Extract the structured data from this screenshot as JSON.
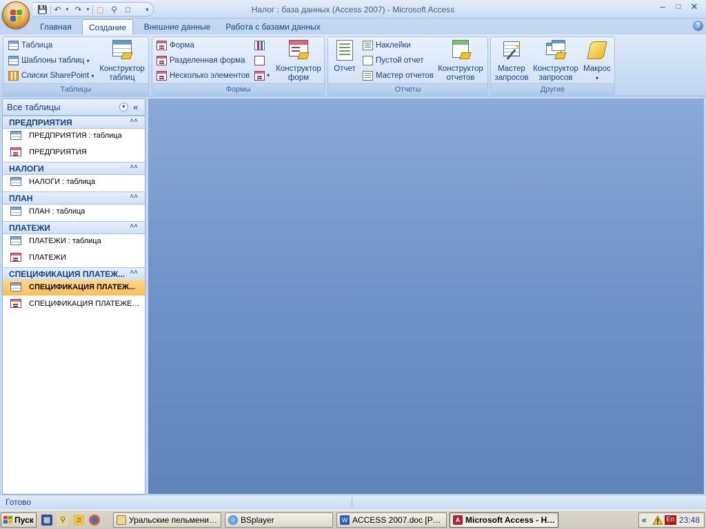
{
  "window": {
    "title": "Налог : база данных (Access 2007) - Microsoft Access"
  },
  "tabs": [
    {
      "label": "Главная"
    },
    {
      "label": "Создание",
      "active": true
    },
    {
      "label": "Внешние данные"
    },
    {
      "label": "Работа с базами данных"
    }
  ],
  "ribbon": {
    "tables": {
      "label": "Таблицы",
      "table": "Таблица",
      "templates": "Шаблоны таблиц",
      "sharepoint": "Списки SharePoint",
      "designer_line1": "Конструктор",
      "designer_line2": "таблиц"
    },
    "forms": {
      "label": "Формы",
      "form": "Форма",
      "split": "Разделенная форма",
      "multiple": "Несколько элементов",
      "designer_line1": "Конструктор",
      "designer_line2": "форм"
    },
    "reports": {
      "label": "Отчеты",
      "report": "Отчет",
      "labels": "Наклейки",
      "empty": "Пустой отчет",
      "wizard": "Мастер отчетов",
      "designer_line1": "Конструктор",
      "designer_line2": "отчетов"
    },
    "other": {
      "label": "Другие",
      "query_wizard_line1": "Мастер",
      "query_wizard_line2": "запросов",
      "query_designer_line1": "Конструктор",
      "query_designer_line2": "запросов",
      "macro": "Макрос"
    }
  },
  "nav": {
    "header": "Все таблицы",
    "groups": [
      {
        "title": "ПРЕДПРИЯТИЯ",
        "items": [
          {
            "label": "ПРЕДПРИЯТИЯ : таблица",
            "type": "table"
          },
          {
            "label": "ПРЕДПРИЯТИЯ",
            "type": "form"
          }
        ]
      },
      {
        "title": "НАЛОГИ",
        "items": [
          {
            "label": "НАЛОГИ : таблица",
            "type": "table"
          }
        ]
      },
      {
        "title": "ПЛАН",
        "items": [
          {
            "label": "ПЛАН : таблица",
            "type": "table"
          }
        ]
      },
      {
        "title": "ПЛАТЕЖИ",
        "items": [
          {
            "label": "ПЛАТЕЖИ : таблица",
            "type": "table"
          },
          {
            "label": "ПЛАТЕЖИ",
            "type": "form"
          }
        ]
      },
      {
        "title": "СПЕЦИФИКАЦИЯ ПЛАТЕЖ...",
        "items": [
          {
            "label": "СПЕЦИФИКАЦИЯ ПЛАТЕЖ...",
            "type": "table",
            "selected": true
          },
          {
            "label": "СПЕЦИФИКАЦИЯ ПЛАТЕЖЕЙ ...",
            "type": "form"
          }
        ]
      }
    ]
  },
  "status": {
    "text": "Готово"
  },
  "taskbar": {
    "start": "Пуск",
    "buttons": [
      {
        "label": "Уральские пельмени (Т..."
      },
      {
        "label": "BSplayer"
      },
      {
        "label": "ACCESS 2007.doc [Режи..."
      },
      {
        "label": "Microsoft Access - На...",
        "active": true
      }
    ],
    "tray": {
      "lang": "En",
      "clock": "23:48"
    }
  }
}
